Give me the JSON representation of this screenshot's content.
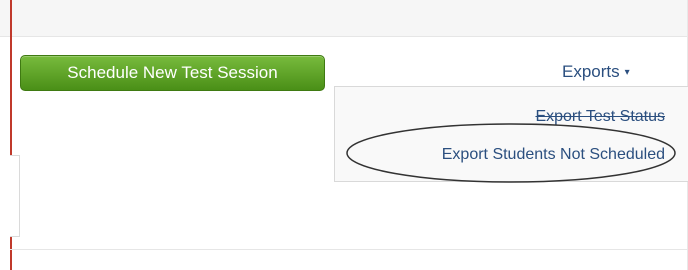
{
  "toolbar": {
    "schedule_button_label": "Schedule New Test Session",
    "exports_label": "Exports",
    "exports_caret": "▾"
  },
  "exports_menu": {
    "items": [
      {
        "label": "Export Test Status"
      },
      {
        "label": "Export Students Not Scheduled"
      }
    ]
  },
  "colors": {
    "button_green": "#5fa02a",
    "link_blue": "#2b4f7f",
    "annotation_red": "#c0392b"
  },
  "annotation": {
    "shape": "ellipse",
    "target": "Export Students Not Scheduled"
  }
}
